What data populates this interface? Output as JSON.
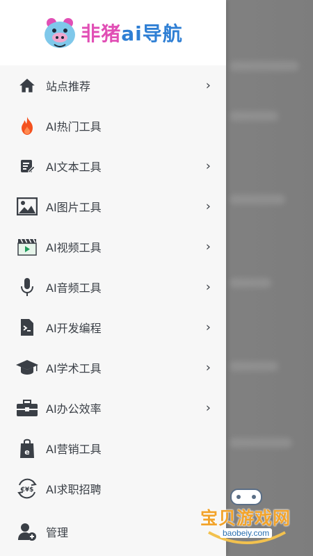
{
  "app": {
    "logo_text_part1": "非猪",
    "logo_text_part2": "ai",
    "logo_text_part3": "导航",
    "logo_icon": "pig-mascot-icon"
  },
  "menu": {
    "items": [
      {
        "label": "站点推荐",
        "icon": "home-icon",
        "has_arrow": true
      },
      {
        "label": "AI热门工具",
        "icon": "fire-icon",
        "has_arrow": false
      },
      {
        "label": "AI文本工具",
        "icon": "edit-document-icon",
        "has_arrow": true
      },
      {
        "label": "AI图片工具",
        "icon": "image-icon",
        "has_arrow": true
      },
      {
        "label": "AI视频工具",
        "icon": "video-clapper-icon",
        "has_arrow": true
      },
      {
        "label": "AI音频工具",
        "icon": "microphone-icon",
        "has_arrow": true
      },
      {
        "label": "AI开发编程",
        "icon": "code-file-icon",
        "has_arrow": true
      },
      {
        "label": "AI学术工具",
        "icon": "graduation-cap-icon",
        "has_arrow": true
      },
      {
        "label": "AI办公效率",
        "icon": "briefcase-icon",
        "has_arrow": true
      },
      {
        "label": "AI营销工具",
        "icon": "shopping-bag-icon",
        "has_arrow": false
      },
      {
        "label": "AI求职招聘",
        "icon": "currency-exchange-icon",
        "has_arrow": false
      },
      {
        "label": "管理",
        "icon": "user-add-icon",
        "has_arrow": false
      }
    ],
    "arrow_glyph": "›"
  },
  "watermark": {
    "title": "宝贝游戏网",
    "url": "baobeiy.com"
  },
  "colors": {
    "fire": "#f4511e",
    "icon_dark": "#3a3f46",
    "video_green": "#1e9b5a",
    "logo_pink": "#e14fb5",
    "logo_blue": "#2f7fd4"
  }
}
